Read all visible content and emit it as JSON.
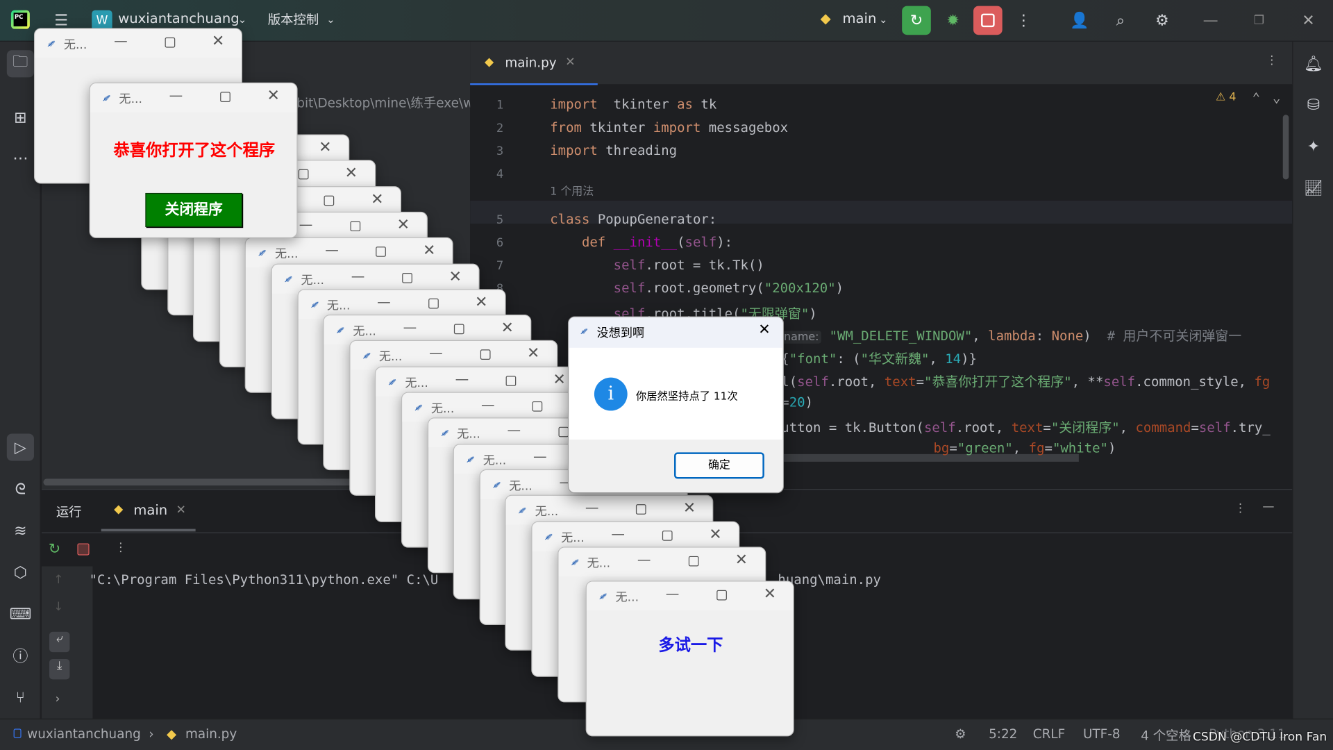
{
  "titlebar": {
    "project_initial": "W",
    "project_name": "wuxiantanchuang",
    "vcs": "版本控制",
    "run_config": "main"
  },
  "project_panel": {
    "path_fragment": "bit\\Desktop\\mine\\练手exe\\w"
  },
  "editor": {
    "tab": "main.py",
    "warnings": "4",
    "usages_hint": "1 个用法",
    "lines": [
      {
        "n": "1",
        "seg": [
          [
            "kw",
            "import"
          ],
          [
            "",
            "  tkinter "
          ],
          [
            "kw",
            "as"
          ],
          [
            "",
            " tk"
          ]
        ]
      },
      {
        "n": "2",
        "seg": [
          [
            "kw",
            "from"
          ],
          [
            "",
            " tkinter "
          ],
          [
            "kw",
            "import"
          ],
          [
            "",
            " messagebox"
          ]
        ]
      },
      {
        "n": "3",
        "seg": [
          [
            "kw",
            "import"
          ],
          [
            "",
            " threading"
          ]
        ]
      },
      {
        "n": "4",
        "seg": []
      },
      {
        "n": "5",
        "seg": [
          [
            "kw",
            "class"
          ],
          [
            "",
            " PopupGenerator:"
          ]
        ]
      },
      {
        "n": "6",
        "seg": [
          [
            "",
            "    "
          ],
          [
            "kw",
            "def"
          ],
          [
            "mg",
            " __init__"
          ],
          [
            "",
            "("
          ],
          [
            "slf",
            "self"
          ],
          [
            "",
            "):"
          ]
        ]
      },
      {
        "n": "7",
        "seg": [
          [
            "",
            "        "
          ],
          [
            "slf",
            "self"
          ],
          [
            "",
            ".root = tk.Tk()"
          ]
        ]
      },
      {
        "n": "8",
        "seg": [
          [
            "",
            "        "
          ],
          [
            "slf",
            "self"
          ],
          [
            "",
            ".root.geometry("
          ],
          [
            "str",
            "\"200x120\""
          ],
          [
            "",
            ")"
          ]
        ]
      },
      {
        "n": "9",
        "seg": [
          [
            "",
            "        "
          ],
          [
            "slf",
            "self"
          ],
          [
            "",
            ".root.title("
          ],
          [
            "str",
            "\"无限弹窗\""
          ],
          [
            "",
            ")"
          ]
        ]
      }
    ],
    "fragments": [
      [
        [
          "hint",
          "name:"
        ],
        [
          "",
          " "
        ],
        [
          "str",
          "\"WM_DELETE_WINDOW\""
        ],
        [
          "",
          ", "
        ],
        [
          "kw",
          "lambda"
        ],
        [
          "",
          ": "
        ],
        [
          "kw",
          "None"
        ],
        [
          "",
          ")  "
        ],
        [
          "cm",
          "# 用户不可关闭弹窗一"
        ]
      ],
      [
        [
          "",
          "{"
        ],
        [
          "str",
          "\"font\""
        ],
        [
          "",
          ": ("
        ],
        [
          "str",
          "\"华文新魏\""
        ],
        [
          "",
          ", "
        ],
        [
          "num",
          "14"
        ],
        [
          "",
          ")}"
        ]
      ],
      [
        [
          "",
          "l("
        ],
        [
          "slf",
          "self"
        ],
        [
          "",
          ".root, "
        ],
        [
          "prm",
          "text"
        ],
        [
          "",
          "="
        ],
        [
          "str",
          "\"恭喜你打开了这个程序\""
        ],
        [
          "",
          ", **"
        ],
        [
          "slf",
          "self"
        ],
        [
          "",
          ".common_style, "
        ],
        [
          "prm",
          "fg"
        ]
      ],
      [
        [
          "",
          "="
        ],
        [
          "num",
          "20"
        ],
        [
          "",
          ")"
        ]
      ],
      [
        [
          "",
          "utton = tk.Button("
        ],
        [
          "slf",
          "self"
        ],
        [
          "",
          ".root, "
        ],
        [
          "prm",
          "text"
        ],
        [
          "",
          "="
        ],
        [
          "str",
          "\"关闭程序\""
        ],
        [
          "",
          ", "
        ],
        [
          "prm",
          "command"
        ],
        [
          "",
          "="
        ],
        [
          "slf",
          "self"
        ],
        [
          "",
          ".try_"
        ]
      ],
      [
        [
          "prm",
          "bg"
        ],
        [
          "",
          "="
        ],
        [
          "str",
          "\"green\""
        ],
        [
          "",
          ", "
        ],
        [
          "prm",
          "fg"
        ],
        [
          "",
          "="
        ],
        [
          "str",
          "\"white\""
        ],
        [
          "",
          ")"
        ]
      ]
    ]
  },
  "run_panel": {
    "title": "运行",
    "tab": "main",
    "output_left": "\"C:\\Program Files\\Python311\\python.exe\" C:\\U",
    "output_right": "huang\\main.py"
  },
  "statusbar": {
    "project": "wuxiantanchuang",
    "file": "main.py",
    "position": "5:22",
    "line_sep": "CRLF",
    "encoding": "UTF-8",
    "indent": "4 个空格",
    "interpreter": "Python 3.11",
    "watermark": "CSDN @CDTU Iron Fan"
  },
  "popups": {
    "title": "无...",
    "main_text": "恭喜你打开了这个程序",
    "close_button": "关闭程序",
    "try_text": "多试一下"
  },
  "dialog": {
    "title": "没想到啊",
    "message": "你居然坚持点了 11次",
    "ok": "确定"
  },
  "colors": {
    "run_green": "#3ea34f",
    "stop_red": "#db5c5c",
    "popup_red": "#ff0000",
    "close_btn_green": "#008000",
    "try_blue": "#1a1ae6",
    "info_blue": "#1e88e5"
  }
}
